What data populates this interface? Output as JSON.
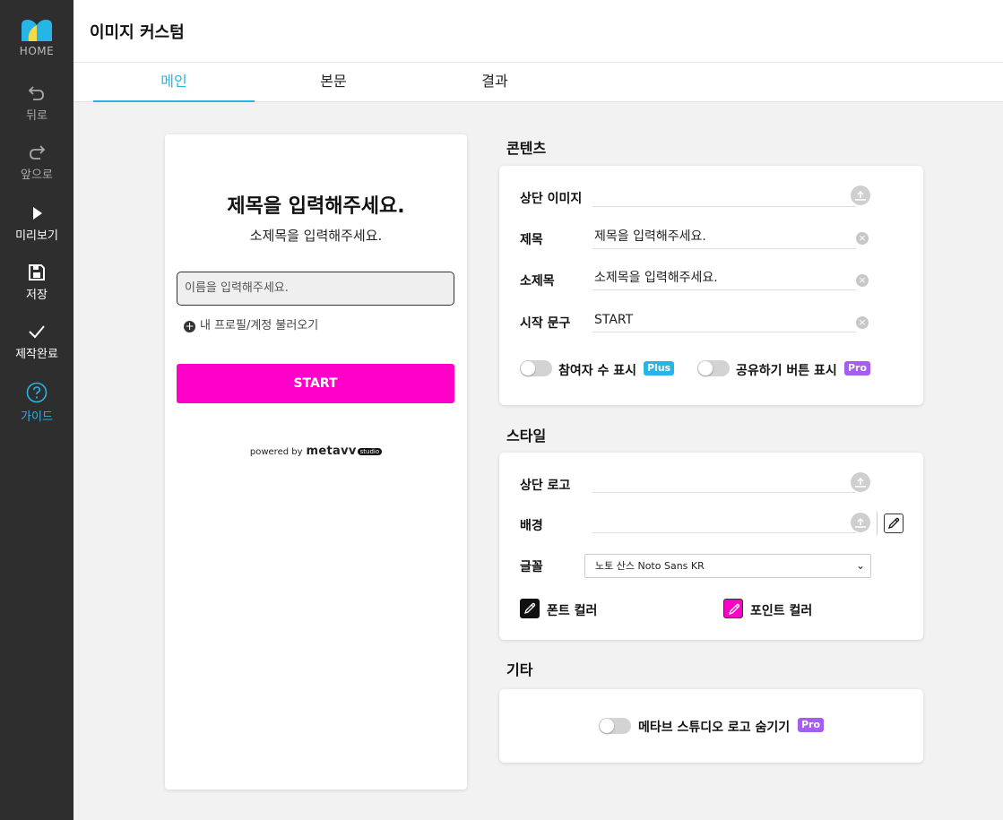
{
  "sidebar": {
    "home": "HOME",
    "back": "뒤로",
    "forward": "앞으로",
    "preview": "미리보기",
    "save": "저장",
    "done": "제작완료",
    "guide": "가이드"
  },
  "header": {
    "title": "이미지 커스텀"
  },
  "tabs": [
    {
      "label": "메인"
    },
    {
      "label": "본문"
    },
    {
      "label": "결과"
    }
  ],
  "preview": {
    "title": "제목을 입력해주세요.",
    "subtitle": "소제목을 입력해주세요.",
    "name_placeholder": "이름을 입력해주세요.",
    "profile_link": "내 프로필/계정 불러오기",
    "start_button": "START",
    "powered_by": "powered by",
    "brand": "metavv",
    "brand_tag": "studio"
  },
  "contents": {
    "heading": "콘텐츠",
    "top_image_label": "상단 이미지",
    "title_label": "제목",
    "title_value": "제목을 입력해주세요.",
    "subtitle_label": "소제목",
    "subtitle_value": "소제목을 입력해주세요.",
    "start_label": "시작 문구",
    "start_value": "START",
    "participants_label": "참여자 수 표시",
    "participants_badge": "Plus",
    "share_label": "공유하기 버튼 표시",
    "share_badge": "Pro"
  },
  "style": {
    "heading": "스타일",
    "logo_label": "상단 로고",
    "background_label": "배경",
    "font_label": "글꼴",
    "font_value": "노토 산스 Noto Sans KR",
    "font_color_label": "폰트 컬러",
    "point_color_label": "포인트 컬러"
  },
  "etc": {
    "heading": "기타",
    "hide_logo_label": "메타브 스튜디오 로고 숨기기",
    "hide_logo_badge": "Pro"
  },
  "colors": {
    "accent": "#27b4e6",
    "start_button": "#ff00c8",
    "font_color": "#111111",
    "point_color": "#ff00c8",
    "plus_badge": "#27b4e6",
    "pro_badge": "#a45ef0"
  }
}
